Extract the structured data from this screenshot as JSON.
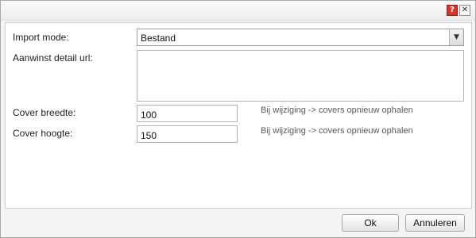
{
  "titlebar": {
    "help_icon": "?",
    "close_icon": "✕"
  },
  "form": {
    "import_mode": {
      "label": "Import mode:",
      "value": "Bestand"
    },
    "detail_url": {
      "label": "Aanwinst detail url:",
      "value": ""
    },
    "cover_width": {
      "label": "Cover breedte:",
      "value": "100",
      "hint": "Bij wijziging -> covers opnieuw ophalen"
    },
    "cover_height": {
      "label": "Cover hoogte:",
      "value": "150",
      "hint": "Bij wijziging -> covers opnieuw ophalen"
    }
  },
  "footer": {
    "ok_label": "Ok",
    "cancel_label": "Annuleren"
  }
}
